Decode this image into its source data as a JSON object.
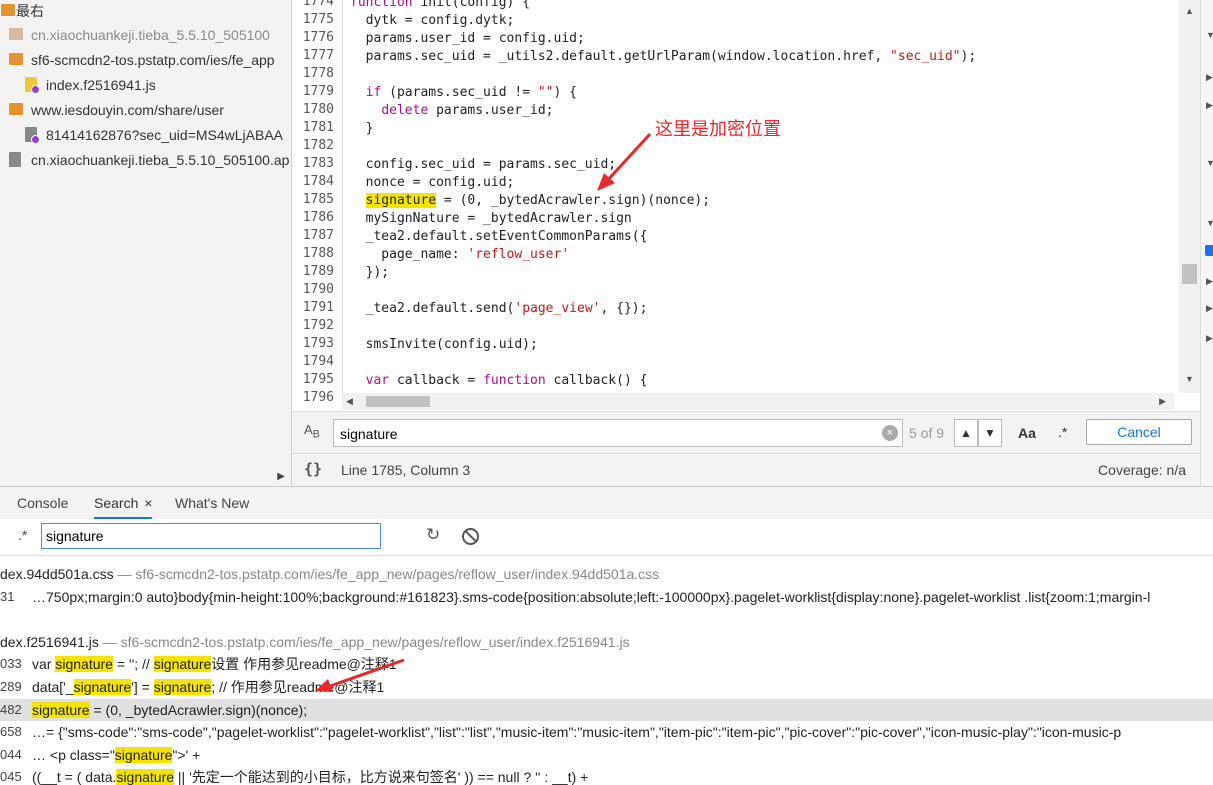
{
  "sidebar": {
    "items": [
      {
        "label": "最右",
        "icon": "folder-icon",
        "muted": false
      },
      {
        "label": "cn.xiaochuankeji.tieba_5.5.10_505100",
        "icon": "folder-icon",
        "muted": true
      },
      {
        "label": "sf6-scmcdn2-tos.pstatp.com/ies/fe_app",
        "icon": "folder-icon",
        "muted": false
      },
      {
        "label": "index.f2516941.js",
        "icon": "js-file-icon",
        "muted": false
      },
      {
        "label": "www.iesdouyin.com/share/user",
        "icon": "folder-icon",
        "muted": false
      },
      {
        "label": "81414162876?sec_uid=MS4wLjABAA",
        "icon": "document-file-icon",
        "muted": false
      },
      {
        "label": "cn.xiaochuankeji.tieba_5.5.10_505100.ap",
        "icon": "document-file-icon",
        "muted": false
      }
    ]
  },
  "editor": {
    "lines": [
      {
        "n": "1774",
        "code": "function init(config) {"
      },
      {
        "n": "1775",
        "code": "  dytk = config.dytk;"
      },
      {
        "n": "1776",
        "code": "  params.user_id = config.uid;"
      },
      {
        "n": "1777",
        "code": "  params.sec_uid = _utils2.default.getUrlParam(window.location.href, \"sec_uid\");"
      },
      {
        "n": "1778",
        "code": ""
      },
      {
        "n": "1779",
        "code": "  if (params.sec_uid != \"\") {"
      },
      {
        "n": "1780",
        "code": "    delete params.user_id;"
      },
      {
        "n": "1781",
        "code": "  }"
      },
      {
        "n": "1782",
        "code": ""
      },
      {
        "n": "1783",
        "code": "  config.sec_uid = params.sec_uid;"
      },
      {
        "n": "1784",
        "code": "  nonce = config.uid;"
      },
      {
        "n": "1785",
        "code": "  signature = (0, _bytedAcrawler.sign)(nonce);"
      },
      {
        "n": "1786",
        "code": "  mySignNature = _bytedAcrawler.sign"
      },
      {
        "n": "1787",
        "code": "  _tea2.default.setEventCommonParams({"
      },
      {
        "n": "1788",
        "code": "    page_name: 'reflow_user'"
      },
      {
        "n": "1789",
        "code": "  });"
      },
      {
        "n": "1790",
        "code": ""
      },
      {
        "n": "1791",
        "code": "  _tea2.default.send('page_view', {});"
      },
      {
        "n": "1792",
        "code": ""
      },
      {
        "n": "1793",
        "code": "  smsInvite(config.uid);"
      },
      {
        "n": "1794",
        "code": ""
      },
      {
        "n": "1795",
        "code": "  var callback = function callback() {"
      },
      {
        "n": "1796",
        "code": ""
      }
    ]
  },
  "annotation": {
    "label": "这里是加密位置"
  },
  "findbar": {
    "query": "signature",
    "count": "5 of 9",
    "case_label": "Aa",
    "regex_label": ".*",
    "cancel_label": "Cancel"
  },
  "statusbar": {
    "position": "Line 1785, Column 3",
    "coverage": "Coverage: n/a",
    "format_icon": "{}"
  },
  "drawer": {
    "tabs": [
      {
        "label": "Console"
      },
      {
        "label": "Search",
        "close": "×"
      },
      {
        "label": "What's New"
      }
    ],
    "regex_label": ".*",
    "query": "signature",
    "results": [
      {
        "type": "file",
        "name": "dex.94dd501a.css",
        "path": "— sf6-scmcdn2-tos.pstatp.com/ies/fe_app_new/pages/reflow_user/index.94dd501a.css"
      },
      {
        "type": "match",
        "n": "31",
        "text": "…750px;margin:0 auto}body{min-height:100%;background:#161823}.sms-code{position:absolute;left:-100000px}.pagelet-worklist{display:none}.pagelet-worklist .list{zoom:1;margin-l"
      },
      {
        "type": "blank"
      },
      {
        "type": "file",
        "name": "dex.f2516941.js",
        "path": "— sf6-scmcdn2-tos.pstatp.com/ies/fe_app_new/pages/reflow_user/index.f2516941.js"
      },
      {
        "type": "match",
        "n": "033",
        "parts": [
          "var ",
          "signature",
          " = ''; // ",
          "signature",
          "设置 作用参见readme@注释1"
        ]
      },
      {
        "type": "match",
        "n": "289",
        "parts": [
          "data['_",
          "signature",
          "'] = ",
          "signature",
          "; // 作用参见readme@注释1"
        ]
      },
      {
        "type": "match",
        "n": "482",
        "selected": true,
        "parts": [
          "",
          "signature",
          " = (0, _bytedAcrawler.sign)(nonce);"
        ]
      },
      {
        "type": "match",
        "n": "658",
        "text": "…= {\"sms-code\":\"sms-code\",\"pagelet-worklist\":\"pagelet-worklist\",\"list\":\"list\",\"music-item\":\"music-item\",\"item-pic\":\"item-pic\",\"pic-cover\":\"pic-cover\",\"icon-music-play\":\"icon-music-p"
      },
      {
        "type": "match",
        "n": "044",
        "parts": [
          "…       <p class=\"",
          "signature",
          "\">' +"
        ]
      },
      {
        "type": "match",
        "n": "045",
        "parts": [
          "((__t = ( data.",
          "signature",
          " || '先定一个能达到的小目标，比方说来句签名' )) == null ? '' : __t) +"
        ]
      }
    ]
  },
  "colors": {
    "highlight": "#f5e400",
    "annotation": "#e8282b",
    "accent": "#1a73e8"
  }
}
